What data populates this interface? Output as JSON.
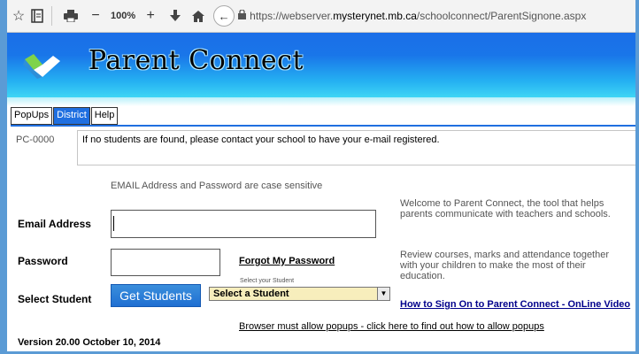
{
  "browser": {
    "zoom_level": "100%",
    "url_prefix": "https://webserver.",
    "url_domain": "mysterynet.mb.ca",
    "url_path": "/schoolconnect/ParentSignone.aspx"
  },
  "banner": {
    "title": "Parent Connect"
  },
  "tabs": [
    {
      "label": "PopUps"
    },
    {
      "label": "District"
    },
    {
      "label": "Help"
    }
  ],
  "notice": {
    "code": "PC-0000",
    "message": "If no students are found, please contact your school to have your e-mail registered."
  },
  "form": {
    "case_note": "EMAIL Address and Password are case sensitive",
    "email_label": "Email Address",
    "email_value": "",
    "password_label": "Password",
    "forgot_label": "Forgot My Password",
    "student_label": "Select Student",
    "get_students_label": "Get Students",
    "select_hint": "Select your Student",
    "select_value": "Select a Student"
  },
  "info": {
    "welcome": "Welcome to Parent Connect, the tool that helps parents communicate with teachers and schools.",
    "review": "Review courses, marks and attendance together with your children to make the most of their education.",
    "video_link": "How to Sign On to Parent Connect - OnLine Video"
  },
  "footer": {
    "popup_link": "Browser must allow popups - click here to find out how to allow popups",
    "version": "Version 20.00 October 10, 2014"
  },
  "colors": {
    "frame": "#5b9bd5",
    "banner_top": "#1b6ee8",
    "banner_bottom": "#3ed6f5",
    "tab_active": "#1f6fe0",
    "select_bg": "#f7eebc",
    "link_dark": "#00008b"
  }
}
